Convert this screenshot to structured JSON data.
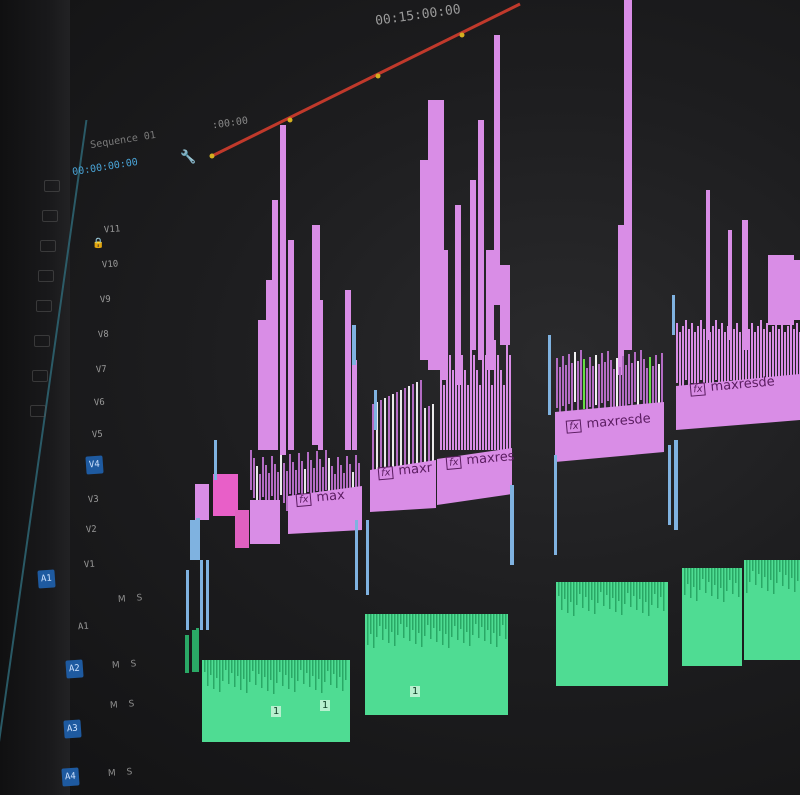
{
  "app": {
    "sequence_timecode": "00:15:00:00",
    "start_timecode": ":00:00"
  },
  "header": {
    "sequence_label": "Sequence 01",
    "timecode_readout": "00:00:00:00"
  },
  "video_tracks": [
    {
      "name": "V11"
    },
    {
      "name": "V10"
    },
    {
      "name": "V9"
    },
    {
      "name": "V8"
    },
    {
      "name": "V7"
    },
    {
      "name": "V6"
    },
    {
      "name": "V5"
    },
    {
      "name": "V4",
      "active": true
    },
    {
      "name": "V3"
    },
    {
      "name": "V2"
    },
    {
      "name": "V1"
    }
  ],
  "audio_tracks": [
    {
      "name": "A1",
      "controls": "M S"
    },
    {
      "name": "A2",
      "controls": "M S"
    },
    {
      "name": "A3",
      "controls": "M S"
    },
    {
      "name": "A4",
      "controls": "M S"
    }
  ],
  "source_patch": {
    "video": "V1",
    "audio": "A1"
  },
  "clips": {
    "label_text": "maxresde",
    "label_text_short": "maxres",
    "label_text_shorter": "maxr",
    "label_text_min": "max",
    "fx_badge": "fx",
    "audio_marker": "1"
  },
  "colors": {
    "video_clip": "#d98de6",
    "video_clip_dark": "#b46cc4",
    "audio_clip": "#4fdc93",
    "playhead_bar": "#c0392b",
    "marker": "#d4b020",
    "active_track": "#1e5aa0",
    "background": "#1d1d1f"
  },
  "icons": [
    "lock-icon",
    "eye-icon",
    "camera-icon",
    "wrench-icon",
    "fx-icon",
    "speaker-icon"
  ]
}
